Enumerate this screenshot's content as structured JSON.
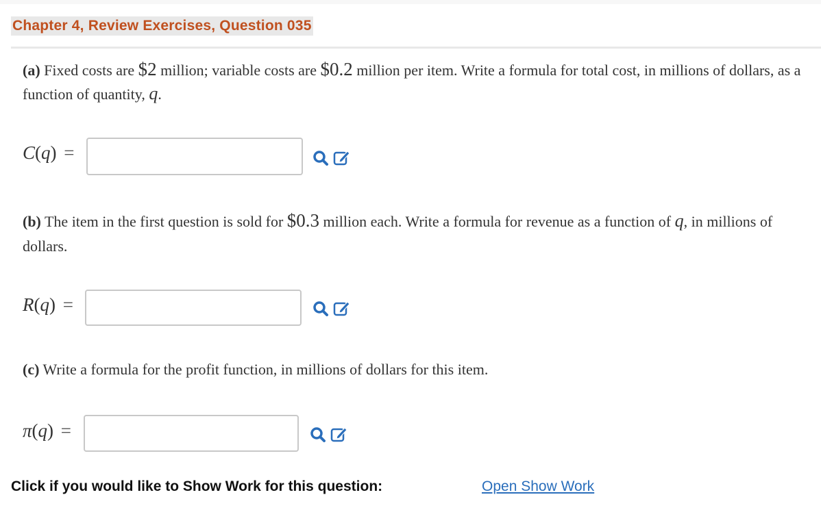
{
  "header": {
    "title": "Chapter 4, Review Exercises, Question 035"
  },
  "questions": [
    {
      "part": "(a)",
      "text_1": " Fixed costs are ",
      "money_1": "$2",
      "text_2": " million; variable costs are ",
      "money_2": "$0.2",
      "text_3": " million per item. Write a formula for total cost, in millions of dollars, as a function of quantity, ",
      "var": "q",
      "text_4": ".",
      "answer_fn": "C",
      "answer_arg": "q",
      "answer_value": "",
      "search_icon": "search-icon",
      "edit_icon": "edit-icon"
    },
    {
      "part": "(b)",
      "text_1": " The item in the first question is sold for ",
      "money_1": "$0.3",
      "text_2": " million each. Write a formula for revenue as a function of ",
      "var": "q",
      "text_3": ", in millions of dollars.",
      "answer_fn": "R",
      "answer_arg": "q",
      "answer_value": "",
      "search_icon": "search-icon",
      "edit_icon": "edit-icon"
    },
    {
      "part": "(c)",
      "text_1": " Write a formula for the profit function, in millions of dollars for this item.",
      "answer_fn": "π",
      "answer_arg": "q",
      "answer_value": "",
      "search_icon": "search-icon",
      "edit_icon": "edit-icon"
    }
  ],
  "equals": "=",
  "show_work": {
    "label": "Click if you would like to Show Work for this question:",
    "link": "Open Show Work"
  },
  "colors": {
    "title": "#c0501f",
    "link": "#2a6ebb",
    "icon": "#2a6ebb"
  }
}
